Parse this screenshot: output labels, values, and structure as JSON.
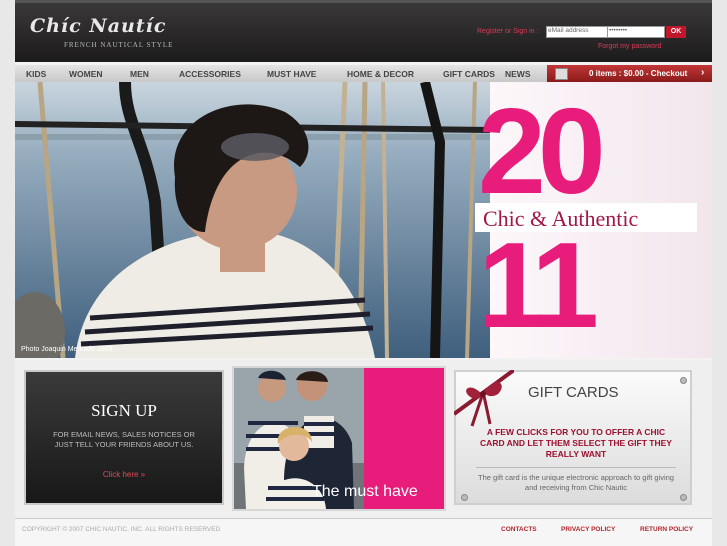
{
  "header": {
    "logo": "Chíc Nautíc",
    "tagline": "FRENCH NAUTICAL STYLE",
    "signin_label": "Register or Sign in :",
    "email_placeholder": "eMail address",
    "password_value": "••••••••",
    "ok_label": "OK",
    "forgot_label": "Forgot my password"
  },
  "nav": {
    "items": [
      "KIDS",
      "WOMEN",
      "MEN",
      "ACCESSORIES",
      "MUST HAVE",
      "HOME & DECOR",
      "GIFT CARDS",
      "NEWS"
    ],
    "cart_text": "0 items : $0.00 - Checkout",
    "cart_arrow": "›"
  },
  "hero": {
    "year_top": "20",
    "year_bottom": "11",
    "tagline": "Chic & Authentic",
    "photo_credit": "Photo Joaquin Mercado 2009"
  },
  "signup": {
    "title": "SIGN UP",
    "text": "FOR EMAIL NEWS, SALES NOTICES OR JUST TELL YOUR FRIENDS ABOUT US.",
    "link": "Click here »"
  },
  "musthave": {
    "label": "The must have"
  },
  "giftcards": {
    "title": "GIFT CARDS",
    "cta": "A FEW CLICKS FOR YOU TO OFFER A CHIC CARD AND LET THEM SELECT THE GIFT THEY REALLY WANT",
    "description": "The gift card is the unique electronic approach to gift giving and receiving from Chic Nautic"
  },
  "footer": {
    "copyright": "COPYRIGHT © 2007 CHIC NAUTIC, INC. ALL RIGHTS RESERVED",
    "links": [
      "CONTACTS",
      "PRIVACY POLICY",
      "RETURN POLICY"
    ]
  },
  "colors": {
    "accent_pink": "#e81c7a",
    "brand_red": "#c0172b",
    "header_dark": "#1c1b1b"
  }
}
